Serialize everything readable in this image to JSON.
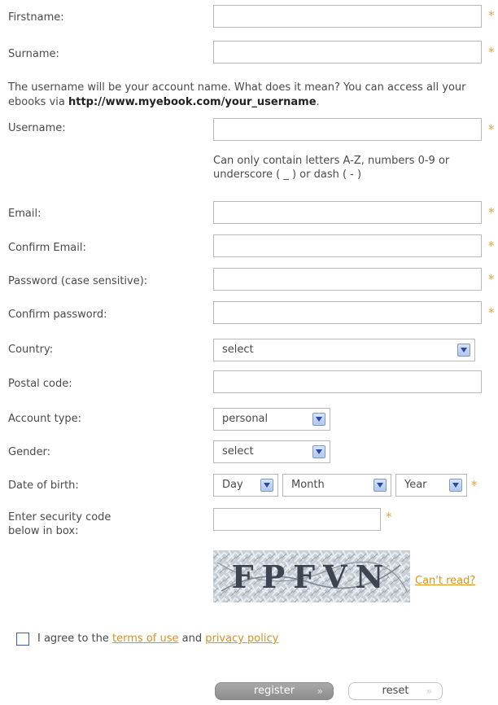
{
  "fields": {
    "firstname": {
      "label": "Firstname:",
      "value": ""
    },
    "surname": {
      "label": "Surname:",
      "value": ""
    },
    "username_note_pre": "The username will be your account name. What does it mean? You can access all your ebooks via ",
    "username_note_url": "http://www.myebook.com/your_username",
    "username_note_post": ".",
    "username": {
      "label": "Username:",
      "value": ""
    },
    "username_hint": "Can only contain letters A-Z, numbers 0-9 or underscore ( _ ) or dash ( - )",
    "email": {
      "label": "Email:",
      "value": ""
    },
    "confirm_email": {
      "label": "Confirm Email:",
      "value": ""
    },
    "password": {
      "label": "Password (case sensitive):",
      "value": ""
    },
    "confirm_password": {
      "label": "Confirm password:",
      "value": ""
    },
    "country": {
      "label": "Country:",
      "selected": "select"
    },
    "postal_code": {
      "label": "Postal code:",
      "value": ""
    },
    "account_type": {
      "label": "Account type:",
      "selected": "personal"
    },
    "gender": {
      "label": "Gender:",
      "selected": "select"
    },
    "date_of_birth": {
      "label": "Date of birth:",
      "day": "Day",
      "month": "Month",
      "year": "Year"
    },
    "security_code": {
      "label_line1": "Enter security code",
      "label_line2": "below in box:",
      "value": ""
    }
  },
  "required_mark": "*",
  "captcha": {
    "text": "FPFVN",
    "cant_read": "Can't read?"
  },
  "agreement": {
    "pre": "I agree to the ",
    "terms": "terms of use",
    "mid": " and ",
    "privacy": "privacy policy",
    "checked": false
  },
  "buttons": {
    "register": "register",
    "reset": "reset",
    "chevron": "»"
  },
  "colors": {
    "accent": "#d9921f",
    "required": "#e8a23a",
    "select_arrow": "#2a4aa8"
  }
}
